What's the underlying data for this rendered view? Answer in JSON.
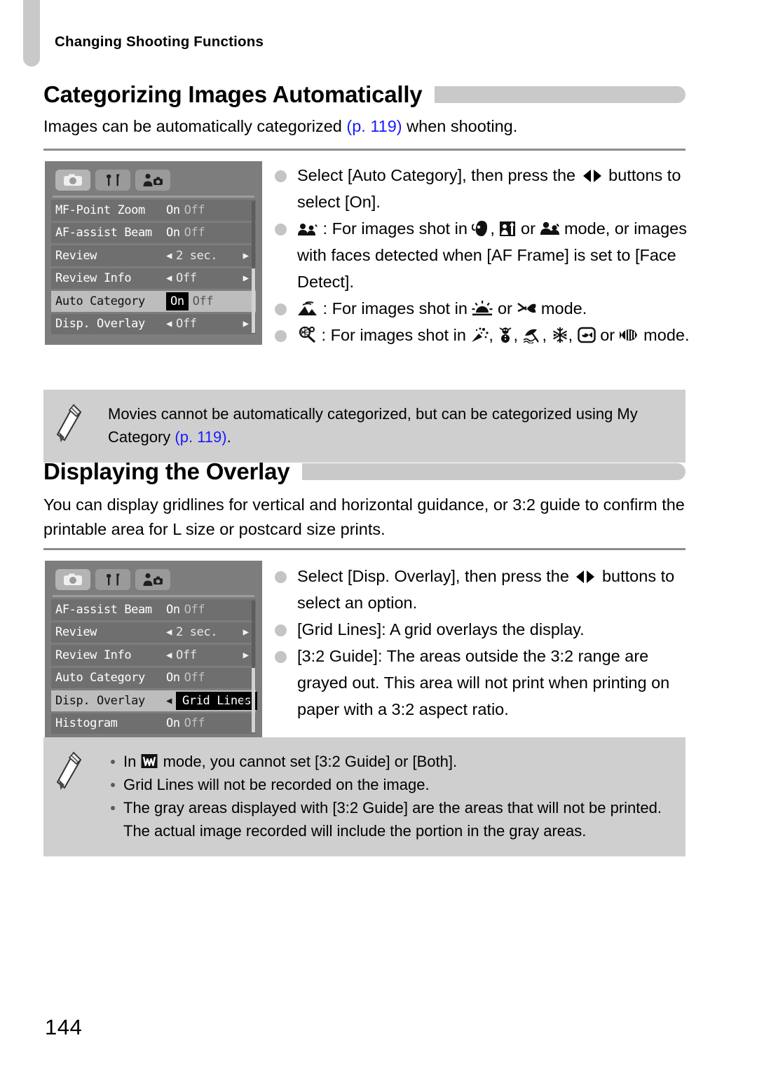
{
  "page": {
    "running_header": "Changing Shooting Functions",
    "page_number": "144"
  },
  "section1": {
    "heading": "Categorizing Images Automatically",
    "intro_before": "Images can be automatically categorized ",
    "intro_ref": "(p. 119)",
    "intro_after": " when shooting.",
    "menu": {
      "tabs": [
        "shooting-tab",
        "setup-tab",
        "my-camera-tab"
      ],
      "rows": [
        {
          "label": "MF-Point Zoom",
          "type": "onoff",
          "on": "On",
          "off": "Off",
          "selected_value": null
        },
        {
          "label": "AF-assist Beam",
          "type": "onoff",
          "on": "On",
          "off": "Off",
          "selected_value": null
        },
        {
          "label": "Review",
          "type": "arrows",
          "value": "2 sec."
        },
        {
          "label": "Review Info",
          "type": "arrows",
          "value": "Off"
        },
        {
          "label": "Auto Category",
          "type": "onoff",
          "on": "On",
          "off": "Off",
          "selected_value": "On",
          "highlighted": true
        },
        {
          "label": "Disp. Overlay",
          "type": "arrows",
          "value": "Off"
        }
      ]
    },
    "steps": [
      {
        "text_a": "Select [Auto Category], then press the ",
        "icon": "lr-buttons-icon",
        "text_b": " buttons to select [On]."
      },
      {
        "lead_icon": "kids-pets-category-icon",
        "text_a": " : For images shot in ",
        "icons": [
          "portrait-mode-icon",
          "night-snapshot-mode-icon",
          "kids-pets-mode-icon"
        ],
        "text_b": " mode, or images with faces detected when [AF Frame] is set to [Face Detect]."
      },
      {
        "lead_icon": "scenery-category-icon",
        "text_a": " : For images shot in ",
        "icons": [
          "sunset-mode-icon",
          "foliage-mode-icon"
        ],
        "text_b": " mode."
      },
      {
        "lead_icon": "events-category-icon",
        "text_a": " : For images shot in ",
        "icons": [
          "fireworks-mode-icon",
          "snow-mode-icon",
          "beach-mode-icon",
          "snowflake-mode-icon",
          "aquarium-mode-icon",
          "underwater-mode-icon"
        ],
        "text_b": " mode."
      }
    ],
    "note": {
      "text_a": "Movies cannot be automatically categorized, but can be categorized using My Category ",
      "ref": "(p. 119)",
      "text_b": "."
    }
  },
  "section2": {
    "heading": "Displaying the Overlay",
    "intro": "You can display gridlines for vertical and horizontal guidance, or 3:2 guide to confirm the printable area for L size or postcard size prints.",
    "menu": {
      "tabs": [
        "shooting-tab",
        "setup-tab",
        "my-camera-tab"
      ],
      "rows": [
        {
          "label": "AF-assist Beam",
          "type": "onoff",
          "on": "On",
          "off": "Off"
        },
        {
          "label": "Review",
          "type": "arrows",
          "value": "2 sec."
        },
        {
          "label": "Review Info",
          "type": "arrows",
          "value": "Off"
        },
        {
          "label": "Auto Category",
          "type": "onoff",
          "on": "On",
          "off": "Off"
        },
        {
          "label": "Disp. Overlay",
          "type": "arrows",
          "value": "Grid Lines",
          "highlighted": true,
          "value_inverted": true
        },
        {
          "label": "Histogram",
          "type": "onoff",
          "on": "On",
          "off": "Off"
        }
      ]
    },
    "steps": [
      {
        "text_a": "Select [Disp. Overlay], then press the ",
        "icon": "lr-buttons-icon",
        "text_b": " buttons to select an option."
      },
      {
        "text_a": "[Grid Lines]: A grid overlays the display."
      },
      {
        "text_a": "[3:2 Guide]: The areas outside the 3:2 range are grayed out. This area will not print when printing on paper with a 3:2 aspect ratio."
      }
    ],
    "note_items": [
      {
        "text_a": "In ",
        "icon": "widescreen-mode-icon",
        "text_b": " mode, you cannot set [3:2 Guide] or [Both]."
      },
      {
        "text_a": "Grid Lines will not be recorded on the image."
      },
      {
        "text_a": "The gray areas displayed with [3:2 Guide] are the areas that will not be printed. The actual image recorded will include the portion in the gray areas."
      }
    ]
  },
  "colors": {
    "accent_link": "#1a1aff",
    "heading_bar": "#c9c9c9",
    "note_bg": "#cfcfcf",
    "lcd_bg": "#7d7d7d"
  }
}
